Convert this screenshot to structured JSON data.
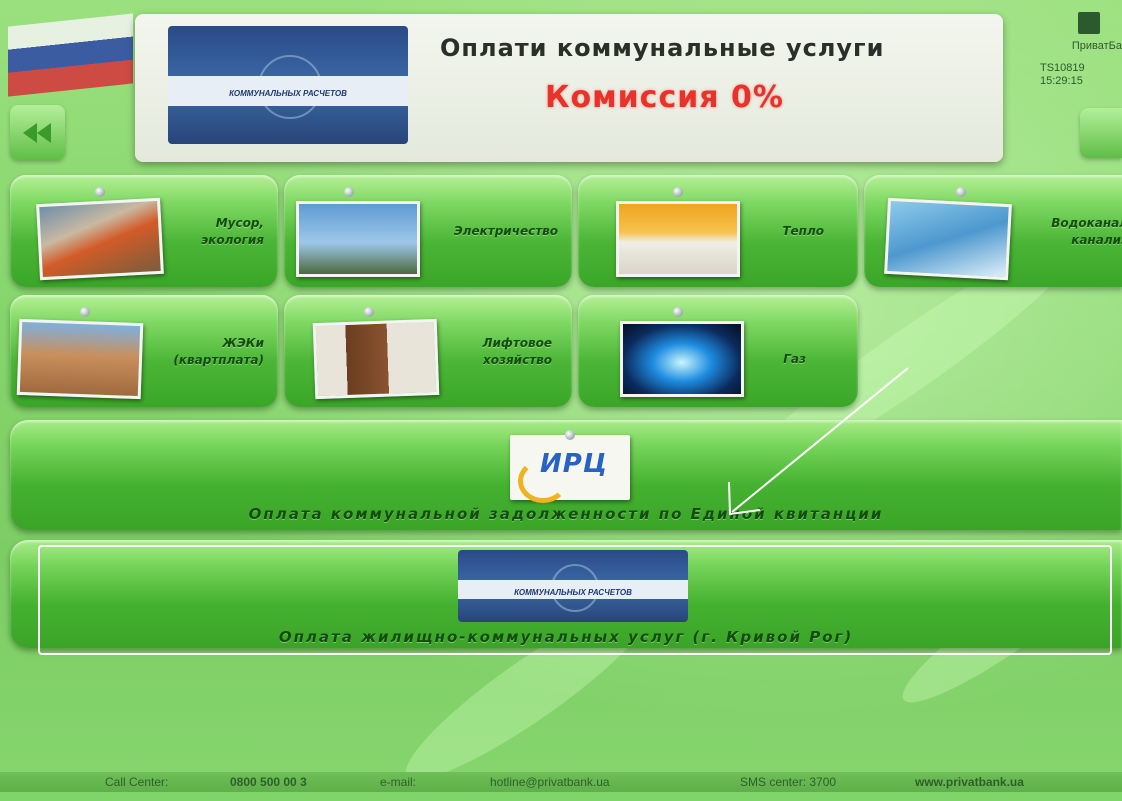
{
  "header": {
    "title": "Оплати коммунальные  услуги",
    "commission": "Комиссия 0%",
    "bank_name": "ПриватБа",
    "terminal_id": "TS10819",
    "time": "15:29:15"
  },
  "services": [
    {
      "label_line1": "Мусор,",
      "label_line2": "экология"
    },
    {
      "label_line1": "Электричество",
      "label_line2": ""
    },
    {
      "label_line1": "Тепло",
      "label_line2": ""
    },
    {
      "label_line1": "Водоканал",
      "label_line2": "канализ"
    },
    {
      "label_line1": "ЖЭКи",
      "label_line2": "(квартплата)"
    },
    {
      "label_line1": "Лифтовое",
      "label_line2": "хозяйство"
    },
    {
      "label_line1": "Газ",
      "label_line2": ""
    }
  ],
  "wide_buttons": {
    "debt_label": "Оплата коммунальной задолженности по Единой квитанции",
    "irc_logo_text": "ИРЦ",
    "housing_label": "Оплата жилищно-коммунальных услуг (г. Кривой Рог)"
  },
  "footer": {
    "call_center_label": "Call Center:",
    "call_center_phone": "0800 500 00 3",
    "email_label": "e-mail:",
    "email": "hotline@privatbank.ua",
    "sms_label": "SMS center: 3700",
    "website": "www.privatbank.ua"
  },
  "colors": {
    "background": "#7fd46a",
    "tile": "#4bb536",
    "commission": "#e9322a",
    "label_text": "#134d10"
  }
}
